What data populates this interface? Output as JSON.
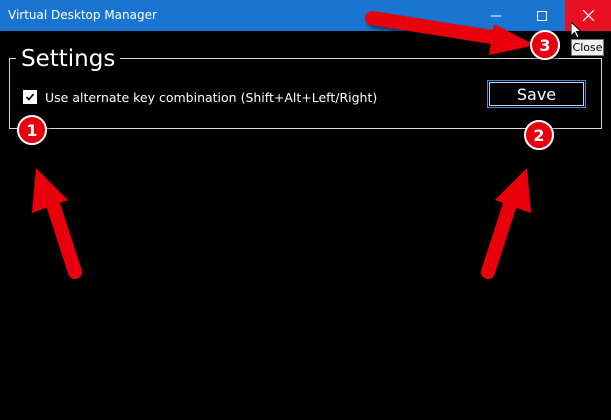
{
  "window": {
    "title": "Virtual Desktop Manager",
    "controls": {
      "minimize_icon": "minimize-icon",
      "maximize_icon": "maximize-icon",
      "close_icon": "close-icon"
    },
    "close_tooltip": "Close"
  },
  "settings": {
    "legend": "Settings",
    "checkbox": {
      "label": "Use alternate key combination (Shift+Alt+Left/Right)",
      "checked": true
    },
    "save_label": "Save"
  },
  "annotations": {
    "badges": [
      "1",
      "2",
      "3"
    ],
    "accent": "#e8000d"
  },
  "colors": {
    "titlebar": "#1a75d2",
    "close_hover": "#e81123",
    "background": "#000000",
    "focus_border": "#2e8ee6"
  }
}
